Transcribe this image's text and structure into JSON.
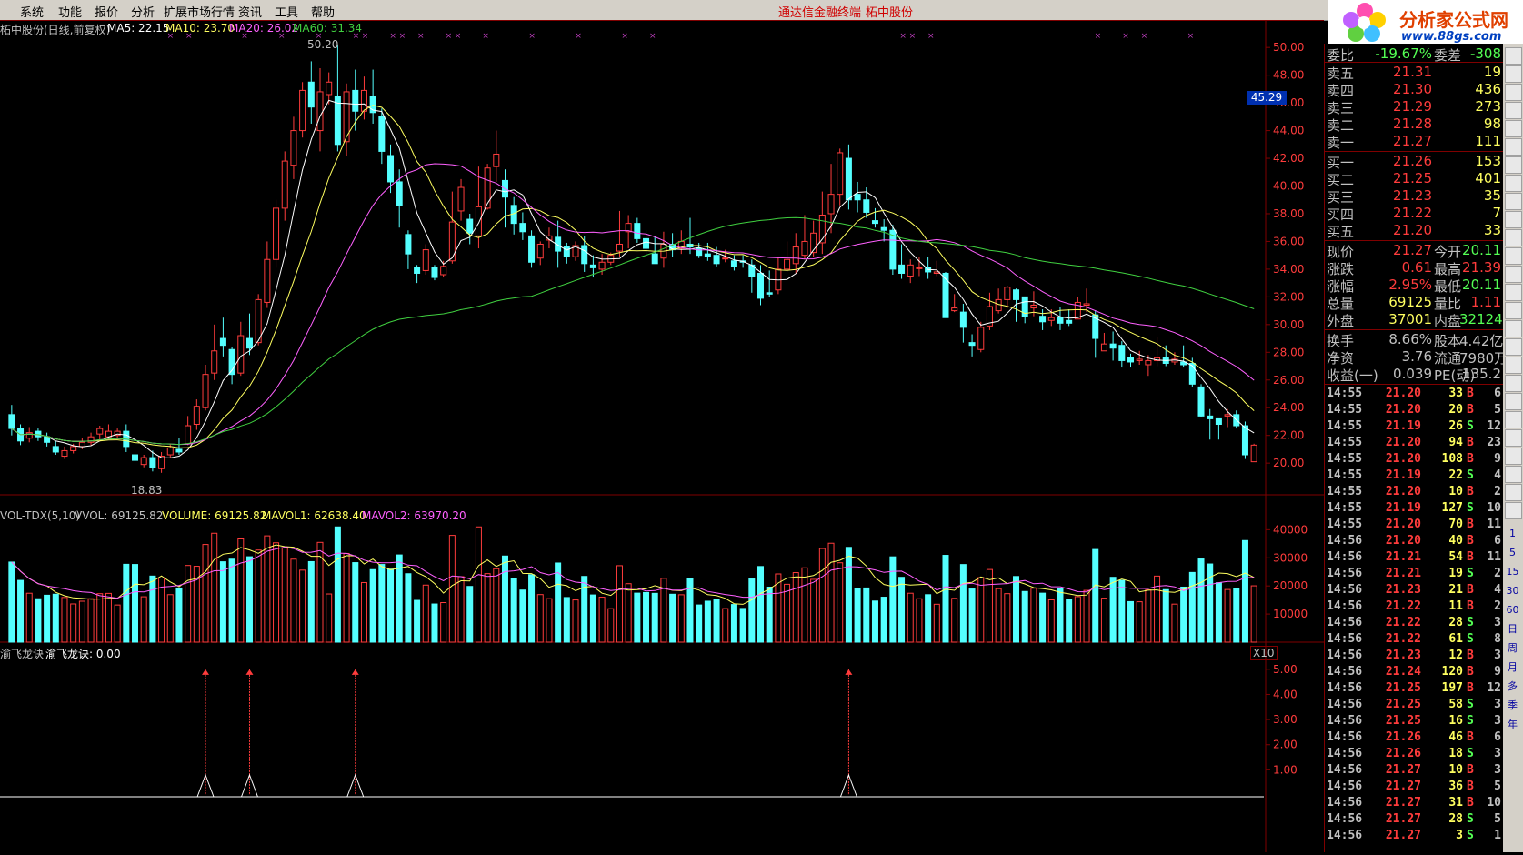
{
  "menu": {
    "items": [
      "系统",
      "功能",
      "报价",
      "分析",
      "扩展市场行情",
      "资讯",
      "工具",
      "帮助"
    ],
    "center_app": "通达信金融终端",
    "center_stock": "柘中股份"
  },
  "logo": {
    "brand": "分析家公式网",
    "url": "www.88gs.com"
  },
  "price_panel": {
    "title": "柘中股份(日线,前复权)",
    "ma5": "MA5: 22.15",
    "ma10": "MA10: 23.70",
    "ma20": "MA20: 26.02",
    "ma60": "MA60: 31.34",
    "high_label": "50.20",
    "low_label": "18.83",
    "marker": "45.29",
    "y_ticks": [
      "50.00",
      "48.00",
      "46.00",
      "44.00",
      "42.00",
      "40.00",
      "38.00",
      "36.00",
      "34.00",
      "32.00",
      "30.00",
      "28.00",
      "26.00",
      "24.00",
      "22.00",
      "20.00"
    ]
  },
  "volume_panel": {
    "title": "VOL-TDX(5,10)",
    "vvol": "VVOL: 69125.82",
    "volume": "VOLUME: 69125.82",
    "mavol1": "MAVOL1: 62638.40",
    "mavol2": "MAVOL2: 63970.20",
    "y_ticks": [
      "40000",
      "30000",
      "20000",
      "10000"
    ],
    "unit": "X10"
  },
  "indicator_panel": {
    "title": "渝飞龙诀",
    "value": "渝飞龙诀: 0.00",
    "y_ticks": [
      "5.00",
      "4.00",
      "3.00",
      "2.00",
      "1.00"
    ]
  },
  "colors": {
    "up": "#ff3c3c",
    "down": "#54ffff",
    "ma5": "#ffffff",
    "ma10": "#ffff60",
    "ma20": "#ff60ff",
    "ma60": "#40d040",
    "grid": "#800000"
  },
  "quote": {
    "webi": {
      "label": "委比",
      "value": "-19.67%",
      "label2": "委差",
      "value2": "-308"
    },
    "asks": [
      {
        "label": "卖五",
        "price": "21.31",
        "vol": "19"
      },
      {
        "label": "卖四",
        "price": "21.30",
        "vol": "436"
      },
      {
        "label": "卖三",
        "price": "21.29",
        "vol": "273"
      },
      {
        "label": "卖二",
        "price": "21.28",
        "vol": "98"
      },
      {
        "label": "卖一",
        "price": "21.27",
        "vol": "111"
      }
    ],
    "bids": [
      {
        "label": "买一",
        "price": "21.26",
        "vol": "153"
      },
      {
        "label": "买二",
        "price": "21.25",
        "vol": "401"
      },
      {
        "label": "买三",
        "price": "21.23",
        "vol": "35"
      },
      {
        "label": "买四",
        "price": "21.22",
        "vol": "7"
      },
      {
        "label": "买五",
        "price": "21.20",
        "vol": "33"
      }
    ],
    "stats": [
      {
        "l1": "现价",
        "v1": "21.27",
        "l2": "今开",
        "v2": "20.11"
      },
      {
        "l1": "涨跌",
        "v1": "0.61",
        "l2": "最高",
        "v2": "21.39"
      },
      {
        "l1": "涨幅",
        "v1": "2.95%",
        "l2": "最低",
        "v2": "20.11"
      },
      {
        "l1": "总量",
        "v1": "69125",
        "l2": "量比",
        "v2": "1.11"
      },
      {
        "l1": "外盘",
        "v1": "37001",
        "l2": "内盘",
        "v2": "32124"
      }
    ],
    "stats2": [
      {
        "l1": "换手",
        "v1": "8.66%",
        "l2": "股本",
        "v2": "4.42亿"
      },
      {
        "l1": "净资",
        "v1": "3.76",
        "l2": "流通",
        "v2": "7980万"
      },
      {
        "l1": "收益(一)",
        "v1": "0.039",
        "l2": "PE(动)",
        "v2": "135.2"
      }
    ]
  },
  "ticks": [
    {
      "t": "14:55",
      "p": "21.20",
      "v": "33",
      "s": "B",
      "n": "6"
    },
    {
      "t": "14:55",
      "p": "21.20",
      "v": "20",
      "s": "B",
      "n": "5"
    },
    {
      "t": "14:55",
      "p": "21.19",
      "v": "26",
      "s": "S",
      "n": "12"
    },
    {
      "t": "14:55",
      "p": "21.20",
      "v": "94",
      "s": "B",
      "n": "23"
    },
    {
      "t": "14:55",
      "p": "21.20",
      "v": "108",
      "s": "B",
      "n": "9"
    },
    {
      "t": "14:55",
      "p": "21.19",
      "v": "22",
      "s": "S",
      "n": "4"
    },
    {
      "t": "14:55",
      "p": "21.20",
      "v": "10",
      "s": "B",
      "n": "2"
    },
    {
      "t": "14:55",
      "p": "21.19",
      "v": "127",
      "s": "S",
      "n": "10"
    },
    {
      "t": "14:55",
      "p": "21.20",
      "v": "70",
      "s": "B",
      "n": "11"
    },
    {
      "t": "14:56",
      "p": "21.20",
      "v": "40",
      "s": "B",
      "n": "6"
    },
    {
      "t": "14:56",
      "p": "21.21",
      "v": "54",
      "s": "B",
      "n": "11"
    },
    {
      "t": "14:56",
      "p": "21.21",
      "v": "19",
      "s": "S",
      "n": "2"
    },
    {
      "t": "14:56",
      "p": "21.23",
      "v": "21",
      "s": "B",
      "n": "4"
    },
    {
      "t": "14:56",
      "p": "21.22",
      "v": "11",
      "s": "B",
      "n": "2"
    },
    {
      "t": "14:56",
      "p": "21.22",
      "v": "28",
      "s": "S",
      "n": "3"
    },
    {
      "t": "14:56",
      "p": "21.22",
      "v": "61",
      "s": "S",
      "n": "8"
    },
    {
      "t": "14:56",
      "p": "21.23",
      "v": "12",
      "s": "B",
      "n": "3"
    },
    {
      "t": "14:56",
      "p": "21.24",
      "v": "120",
      "s": "B",
      "n": "9"
    },
    {
      "t": "14:56",
      "p": "21.25",
      "v": "197",
      "s": "B",
      "n": "12"
    },
    {
      "t": "14:56",
      "p": "21.25",
      "v": "58",
      "s": "S",
      "n": "3"
    },
    {
      "t": "14:56",
      "p": "21.25",
      "v": "16",
      "s": "S",
      "n": "3"
    },
    {
      "t": "14:56",
      "p": "21.26",
      "v": "46",
      "s": "B",
      "n": "6"
    },
    {
      "t": "14:56",
      "p": "21.26",
      "v": "18",
      "s": "S",
      "n": "3"
    },
    {
      "t": "14:56",
      "p": "21.27",
      "v": "10",
      "s": "B",
      "n": "3"
    },
    {
      "t": "14:56",
      "p": "21.27",
      "v": "36",
      "s": "B",
      "n": "5"
    },
    {
      "t": "14:56",
      "p": "21.27",
      "v": "31",
      "s": "B",
      "n": "10"
    },
    {
      "t": "14:56",
      "p": "21.27",
      "v": "28",
      "s": "S",
      "n": "5"
    },
    {
      "t": "14:56",
      "p": "21.27",
      "v": "3",
      "s": "S",
      "n": "1"
    }
  ],
  "toolbar": [
    "1",
    "5",
    "15",
    "30",
    "60",
    "日",
    "周",
    "月",
    "多",
    "季",
    "年"
  ],
  "chart_data": {
    "type": "candlestick",
    "candles": [
      [
        23.5,
        22.5,
        24.2,
        22.0
      ],
      [
        22.5,
        21.6,
        22.8,
        21.3
      ],
      [
        21.8,
        22.2,
        22.6,
        21.5
      ],
      [
        22.3,
        21.9,
        22.5,
        21.6
      ],
      [
        21.9,
        21.5,
        22.2,
        21.2
      ],
      [
        21.2,
        20.8,
        21.6,
        20.6
      ],
      [
        20.5,
        20.9,
        21.2,
        20.3
      ],
      [
        20.9,
        21.2,
        21.4,
        20.7
      ],
      [
        21.2,
        21.5,
        21.8,
        21.0
      ],
      [
        21.5,
        21.9,
        22.2,
        21.3
      ],
      [
        22.1,
        22.5,
        22.7,
        21.6
      ],
      [
        21.9,
        22.3,
        22.8,
        21.7
      ],
      [
        22.0,
        22.3,
        22.5,
        21.8
      ],
      [
        22.3,
        21.2,
        22.8,
        20.8
      ],
      [
        20.6,
        20.2,
        20.9,
        19.0
      ],
      [
        19.9,
        20.4,
        20.6,
        19.7
      ],
      [
        20.4,
        19.7,
        20.9,
        19.4
      ],
      [
        19.6,
        20.5,
        20.8,
        19.3
      ],
      [
        20.6,
        21.1,
        21.4,
        20.4
      ],
      [
        21.0,
        20.8,
        21.8,
        20.6
      ],
      [
        21.4,
        22.7,
        23.4,
        21.3
      ],
      [
        22.8,
        24.1,
        24.6,
        22.4
      ],
      [
        24.0,
        26.4,
        27.1,
        23.8
      ],
      [
        26.5,
        28.1,
        30.0,
        26.0
      ],
      [
        29.0,
        28.5,
        30.5,
        27.7
      ],
      [
        28.2,
        26.4,
        28.4,
        25.7
      ],
      [
        26.5,
        29.2,
        30.2,
        26.3
      ],
      [
        29.0,
        28.3,
        30.8,
        27.8
      ],
      [
        28.7,
        31.8,
        32.2,
        28.5
      ],
      [
        31.6,
        34.7,
        36.0,
        31.2
      ],
      [
        34.7,
        38.4,
        39.0,
        34.1
      ],
      [
        38.4,
        41.8,
        42.5,
        37.5
      ],
      [
        41.5,
        44.0,
        45.0,
        40.5
      ],
      [
        44.0,
        46.9,
        47.5,
        43.5
      ],
      [
        47.5,
        45.7,
        49.0,
        44.5
      ],
      [
        44.0,
        46.8,
        48.5,
        42.5
      ],
      [
        46.6,
        47.5,
        48.2,
        45.9
      ],
      [
        46.5,
        43.0,
        50.2,
        42.5
      ],
      [
        43.2,
        46.8,
        47.4,
        42.2
      ],
      [
        46.9,
        45.4,
        48.4,
        44.0
      ],
      [
        45.4,
        46.9,
        47.9,
        44.8
      ],
      [
        46.5,
        45.3,
        48.4,
        44.5
      ],
      [
        45.0,
        42.5,
        45.6,
        41.6
      ],
      [
        42.2,
        40.3,
        43.0,
        39.5
      ],
      [
        40.3,
        38.6,
        41.2,
        37.0
      ],
      [
        36.5,
        35.1,
        36.8,
        34.0
      ],
      [
        34.1,
        33.7,
        34.3,
        33.0
      ],
      [
        33.9,
        35.4,
        35.8,
        33.6
      ],
      [
        34.1,
        33.4,
        34.3,
        33.2
      ],
      [
        33.6,
        34.2,
        34.6,
        33.4
      ],
      [
        34.6,
        37.4,
        39.6,
        34.4
      ],
      [
        38.2,
        39.9,
        40.5,
        37.5
      ],
      [
        37.6,
        36.6,
        38.0,
        35.8
      ],
      [
        36.4,
        38.5,
        41.4,
        35.5
      ],
      [
        38.4,
        41.3,
        41.6,
        38.3
      ],
      [
        41.4,
        42.3,
        44.0,
        40.3
      ],
      [
        40.4,
        39.2,
        41.2,
        37.0
      ],
      [
        38.6,
        37.3,
        39.2,
        36.5
      ],
      [
        37.3,
        36.7,
        38.1,
        36.1
      ],
      [
        36.4,
        34.5,
        36.8,
        34.1
      ],
      [
        34.8,
        35.8,
        36.0,
        34.3
      ],
      [
        36.1,
        36.4,
        37.0,
        35.5
      ],
      [
        36.3,
        35.3,
        37.5,
        34.1
      ],
      [
        35.6,
        34.9,
        35.9,
        34.4
      ],
      [
        34.9,
        35.7,
        36.0,
        34.6
      ],
      [
        35.7,
        34.4,
        36.4,
        33.8
      ],
      [
        34.3,
        34.1,
        35.0,
        33.4
      ],
      [
        34.0,
        34.5,
        35.1,
        33.6
      ],
      [
        34.5,
        35.0,
        35.2,
        34.3
      ],
      [
        35.3,
        35.8,
        38.2,
        34.9
      ],
      [
        36.7,
        37.3,
        37.9,
        35.5
      ],
      [
        37.3,
        36.2,
        37.7,
        35.9
      ],
      [
        36.2,
        35.5,
        36.8,
        35.0
      ],
      [
        35.1,
        34.4,
        36.4,
        34.7
      ],
      [
        34.8,
        35.8,
        36.7,
        34.1
      ],
      [
        35.8,
        35.4,
        36.6,
        34.9
      ],
      [
        35.5,
        36.0,
        36.8,
        35.1
      ],
      [
        35.8,
        35.6,
        37.7,
        35.1
      ],
      [
        35.5,
        35.0,
        35.9,
        34.8
      ],
      [
        35.1,
        34.9,
        35.9,
        34.6
      ],
      [
        35.0,
        34.4,
        35.6,
        34.2
      ],
      [
        34.8,
        34.8,
        35.4,
        34.5
      ],
      [
        34.6,
        34.2,
        35.0,
        33.9
      ],
      [
        34.6,
        34.5,
        35.0,
        34.1
      ],
      [
        34.3,
        33.5,
        34.7,
        32.3
      ],
      [
        33.7,
        31.9,
        34.3,
        31.4
      ],
      [
        32.3,
        32.2,
        33.9,
        32.0
      ],
      [
        32.5,
        34.0,
        34.9,
        32.2
      ],
      [
        34.0,
        34.7,
        36.0,
        33.8
      ],
      [
        34.4,
        35.6,
        36.6,
        33.7
      ],
      [
        35.0,
        36.0,
        37.9,
        34.7
      ],
      [
        35.2,
        36.6,
        37.5,
        34.9
      ],
      [
        35.9,
        37.9,
        39.6,
        35.1
      ],
      [
        38.0,
        39.4,
        41.6,
        36.6
      ],
      [
        39.4,
        42.4,
        42.7,
        38.6
      ],
      [
        42.0,
        39.0,
        43.0,
        38.3
      ],
      [
        39.4,
        39.0,
        40.3,
        38.1
      ],
      [
        39.0,
        38.1,
        39.9,
        37.7
      ],
      [
        37.5,
        37.3,
        38.4,
        37.0
      ],
      [
        37.0,
        36.8,
        37.6,
        36.0
      ],
      [
        36.8,
        34.0,
        37.2,
        33.6
      ],
      [
        34.3,
        33.7,
        35.8,
        33.3
      ],
      [
        33.5,
        34.3,
        34.7,
        33.0
      ],
      [
        34.1,
        34.1,
        34.9,
        33.5
      ],
      [
        34.1,
        33.8,
        34.9,
        33.3
      ],
      [
        33.7,
        33.8,
        34.6,
        33.5
      ],
      [
        33.7,
        30.5,
        33.8,
        30.5
      ],
      [
        31.0,
        31.2,
        32.2,
        30.9
      ],
      [
        30.9,
        29.8,
        31.5,
        28.7
      ],
      [
        28.7,
        28.5,
        29.3,
        27.7
      ],
      [
        28.2,
        29.8,
        30.2,
        28.0
      ],
      [
        29.9,
        31.3,
        32.3,
        29.6
      ],
      [
        31.0,
        31.8,
        32.6,
        30.8
      ],
      [
        31.8,
        32.7,
        32.8,
        31.2
      ],
      [
        32.5,
        31.8,
        32.6,
        30.2
      ],
      [
        32.0,
        30.6,
        31.7,
        30.1
      ],
      [
        31.2,
        31.4,
        32.4,
        30.6
      ],
      [
        30.6,
        30.2,
        31.1,
        29.6
      ],
      [
        30.3,
        30.5,
        31.1,
        29.9
      ],
      [
        30.5,
        30.1,
        31.3,
        29.6
      ],
      [
        30.3,
        30.1,
        31.1,
        29.9
      ],
      [
        30.4,
        31.6,
        32.0,
        30.6
      ],
      [
        31.4,
        31.5,
        32.6,
        30.9
      ],
      [
        30.7,
        29.0,
        31.0,
        27.6
      ],
      [
        28.1,
        28.6,
        29.4,
        28.2
      ],
      [
        28.6,
        28.3,
        29.5,
        27.4
      ],
      [
        28.5,
        27.4,
        28.8,
        26.9
      ],
      [
        27.6,
        27.3,
        27.9,
        26.9
      ],
      [
        27.4,
        27.5,
        28.1,
        27.1
      ],
      [
        27.1,
        27.4,
        27.8,
        26.3
      ],
      [
        27.4,
        27.6,
        29.1,
        27.0
      ],
      [
        27.6,
        27.2,
        28.5,
        27.0
      ],
      [
        27.3,
        27.5,
        28.0,
        27.1
      ],
      [
        27.3,
        27.1,
        28.5,
        26.9
      ],
      [
        27.2,
        25.7,
        27.6,
        25.5
      ],
      [
        25.5,
        23.4,
        25.7,
        23.3
      ],
      [
        23.4,
        23.2,
        23.9,
        21.7
      ],
      [
        23.2,
        22.8,
        23.2,
        21.7
      ],
      [
        23.4,
        23.5,
        23.9,
        22.6
      ],
      [
        23.5,
        22.7,
        23.8,
        22.5
      ],
      [
        22.7,
        20.6,
        23.0,
        20.3
      ],
      [
        20.1,
        21.3,
        21.4,
        20.1
      ]
    ],
    "volume_note": "volume values in lots"
  }
}
